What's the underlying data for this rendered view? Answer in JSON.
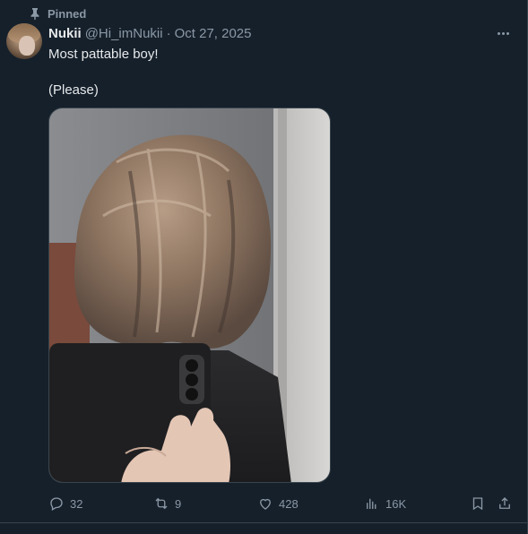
{
  "pinned": {
    "label": "Pinned",
    "icon": "pin-icon"
  },
  "author": {
    "name": "Nukii",
    "handle": "@Hi_imNukii",
    "separator": "·",
    "date": "Oct 27, 2025"
  },
  "tweet": {
    "lines": [
      "Most pattable boy!",
      "",
      "(Please)"
    ]
  },
  "media": {
    "description_icon": "photo"
  },
  "actions": {
    "reply": {
      "icon": "reply-icon",
      "count": "32"
    },
    "retweet": {
      "icon": "retweet-icon",
      "count": "9"
    },
    "like": {
      "icon": "heart-icon",
      "count": "428"
    },
    "views": {
      "icon": "views-icon",
      "count": "16K"
    },
    "bookmark": {
      "icon": "bookmark-icon"
    },
    "share": {
      "icon": "share-icon"
    }
  },
  "colors": {
    "background": "#15202b",
    "text": "#e7e9ea",
    "muted": "#8b98a5",
    "border": "#38444d"
  }
}
